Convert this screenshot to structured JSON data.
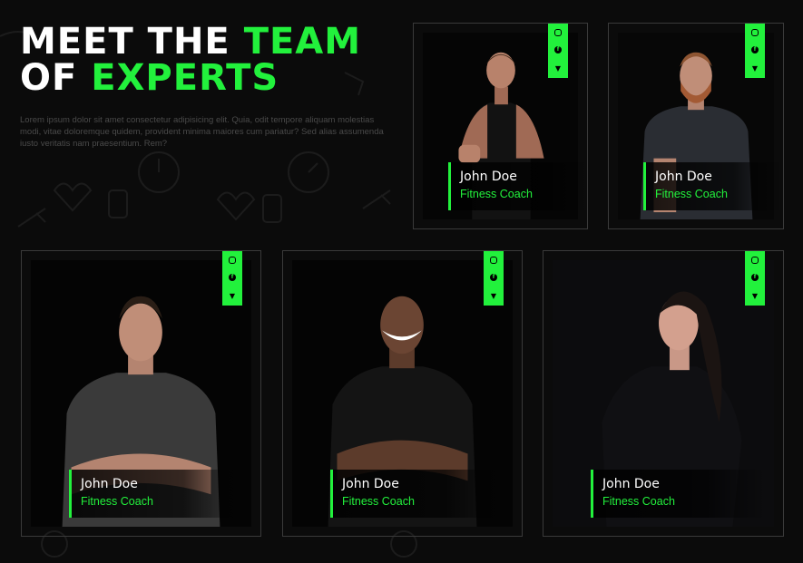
{
  "hero": {
    "title_line1_white": "MEET THE ",
    "title_line1_green": "TEAM",
    "title_line2_white": "OF ",
    "title_line2_green": "EXPERTS",
    "description": "Lorem ipsum dolor sit amet consectetur adipisicing elit. Quia, odit tempore aliquam molestias modi, vitae doloremque quidem, provident minima maiores cum pariatur? Sed alias assumenda iusto veritatis nam praesentium. Rem?"
  },
  "team": [
    {
      "name": "John Doe",
      "role": "Fitness Coach"
    },
    {
      "name": "John Doe",
      "role": "Fitness Coach"
    },
    {
      "name": "John Doe",
      "role": "Fitness Coach"
    },
    {
      "name": "John Doe",
      "role": "Fitness Coach"
    },
    {
      "name": "John Doe",
      "role": "Fitness Coach"
    }
  ],
  "social_icons": [
    "instagram-icon",
    "facebook-icon",
    "twitter-icon"
  ],
  "colors": {
    "accent": "#22f13c",
    "background": "#0b0b0b",
    "card_border": "#3a3a3a"
  }
}
